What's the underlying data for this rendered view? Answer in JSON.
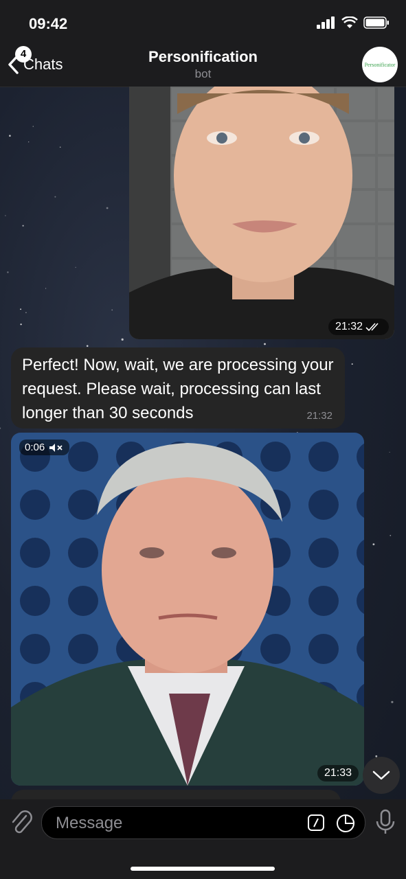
{
  "status_bar": {
    "time": "09:42"
  },
  "header": {
    "back_label": "Chats",
    "unread_count": "4",
    "title": "Personification",
    "subtitle": "bot",
    "avatar_text": "Personificator"
  },
  "messages": {
    "outgoing_photo": {
      "time": "21:32",
      "status": "read"
    },
    "bot_text": {
      "text": "Perfect! Now, wait, we are processing your request. Please wait, processing can last longer than 30 seconds",
      "time": "21:32"
    },
    "bot_video": {
      "duration": "0:06",
      "muted": true,
      "time": "21:33"
    }
  },
  "input": {
    "placeholder": "Message"
  },
  "icons": {
    "back": "chevron-left-icon",
    "attach": "paperclip-icon",
    "command": "slash-command-icon",
    "sticker": "sticker-icon",
    "mic": "microphone-icon",
    "scroll": "chevron-down-icon"
  },
  "colors": {
    "accent": "#ffffff",
    "bubble": "#252525",
    "bar": "#1c1c1e"
  }
}
